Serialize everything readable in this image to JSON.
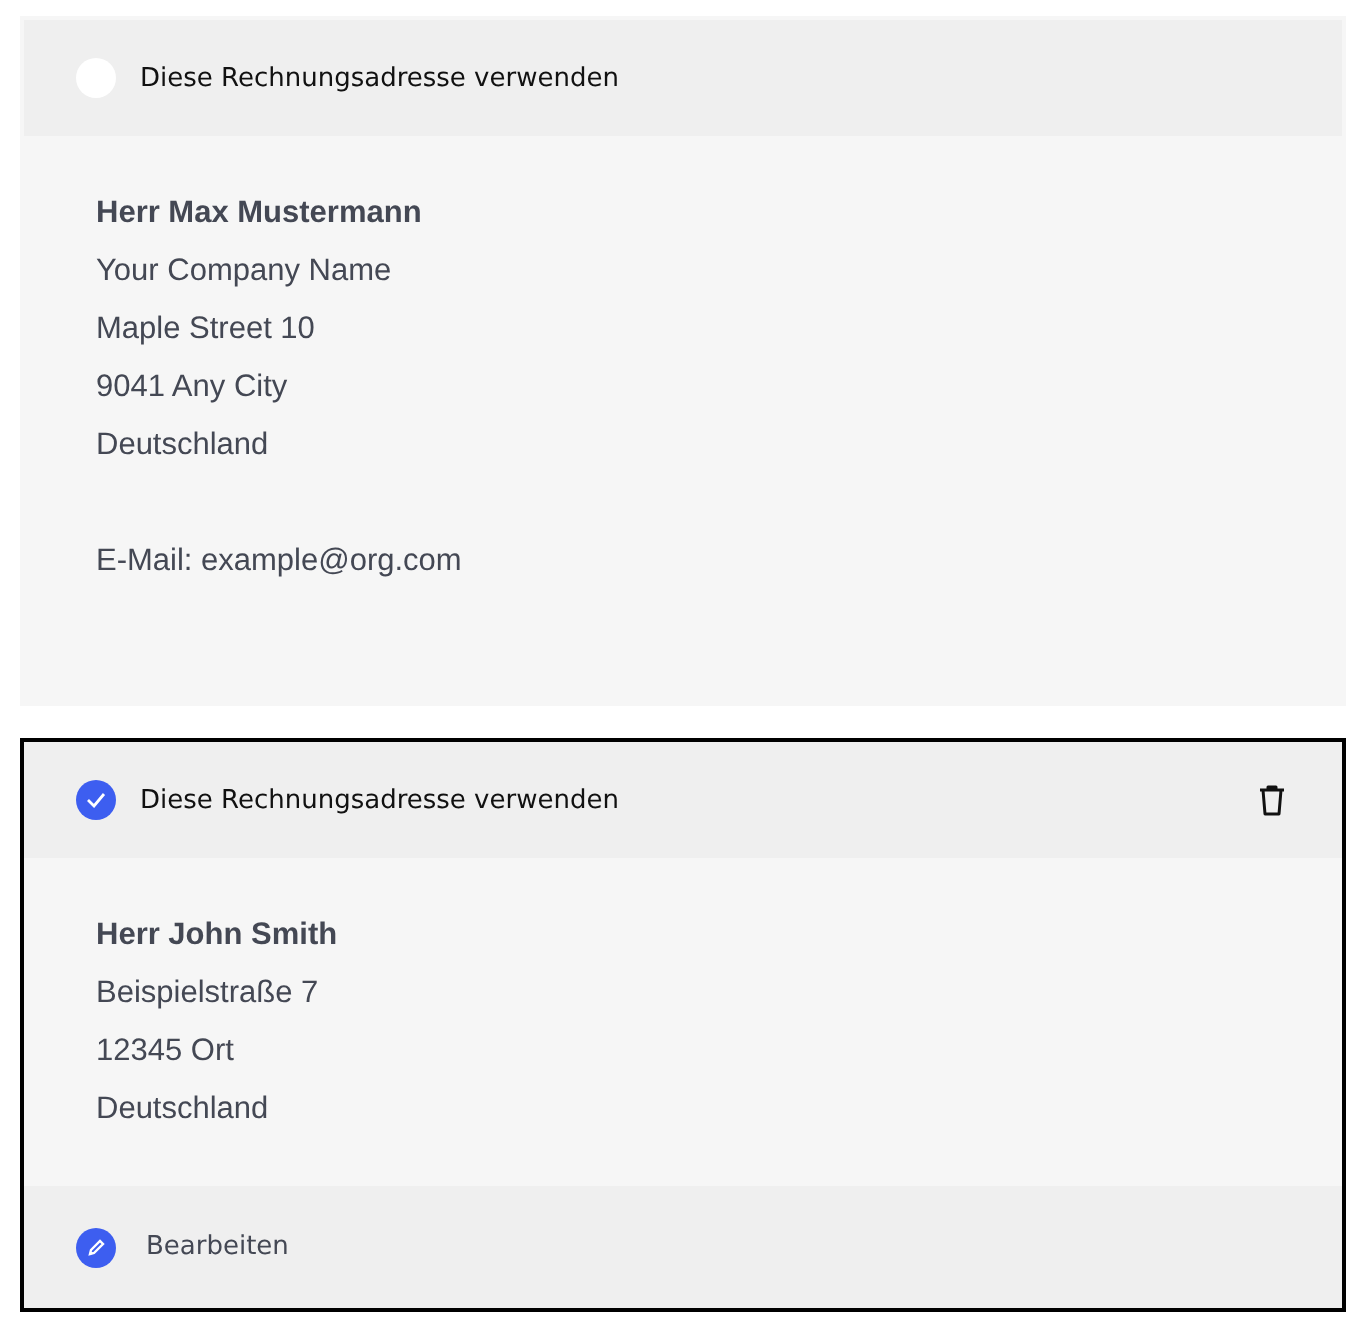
{
  "addresses": [
    {
      "selected": false,
      "option_label": "Diese Rechnungsadresse verwenden",
      "name": "Herr Max Mustermann",
      "lines": [
        "Your Company Name",
        "Maple Street 10",
        "9041 Any City",
        "Deutschland"
      ],
      "email": "E-Mail: example@org.com",
      "deletable": false
    },
    {
      "selected": true,
      "option_label": "Diese Rechnungsadresse verwenden",
      "name": "Herr John Smith",
      "lines": [
        "Beispielstraße 7",
        "12345 Ort",
        "Deutschland"
      ],
      "deletable": true,
      "edit_label": "Bearbeiten"
    }
  ]
}
